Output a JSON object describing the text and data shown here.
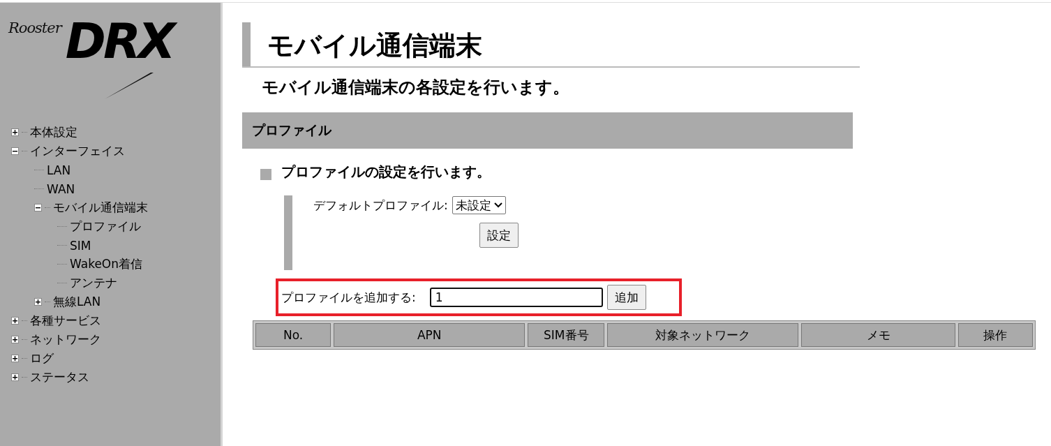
{
  "logo": {
    "small": "Rooster",
    "large": "DRX"
  },
  "tree": [
    {
      "label": "本体設定",
      "kind": "folder",
      "expanded": false
    },
    {
      "label": "インターフェイス",
      "kind": "folder",
      "expanded": true,
      "children": [
        {
          "label": "LAN",
          "kind": "leaf"
        },
        {
          "label": "WAN",
          "kind": "leaf"
        },
        {
          "label": "モバイル通信端末",
          "kind": "folder",
          "expanded": true,
          "children": [
            {
              "label": "プロファイル",
              "kind": "leaf"
            },
            {
              "label": "SIM",
              "kind": "leaf"
            },
            {
              "label": "WakeOn着信",
              "kind": "leaf"
            },
            {
              "label": "アンテナ",
              "kind": "leaf"
            }
          ]
        },
        {
          "label": "無線LAN",
          "kind": "folder",
          "expanded": false
        }
      ]
    },
    {
      "label": "各種サービス",
      "kind": "folder",
      "expanded": false
    },
    {
      "label": "ネットワーク",
      "kind": "folder",
      "expanded": false
    },
    {
      "label": "ログ",
      "kind": "folder",
      "expanded": false
    },
    {
      "label": "ステータス",
      "kind": "folder",
      "expanded": false
    }
  ],
  "page": {
    "title": "モバイル通信端末",
    "subtitle": "モバイル通信端末の各設定を行います。"
  },
  "section": {
    "title": "プロファイル",
    "description": "プロファイルの設定を行います。",
    "default_profile": {
      "label": "デフォルトプロファイル:",
      "value": "未設定",
      "button": "設定"
    },
    "add_profile": {
      "label": "プロファイルを追加する:",
      "value": "1",
      "button": "追加"
    },
    "table": {
      "columns": [
        "No.",
        "APN",
        "SIM番号",
        "対象ネットワーク",
        "メモ",
        "操作"
      ]
    }
  }
}
